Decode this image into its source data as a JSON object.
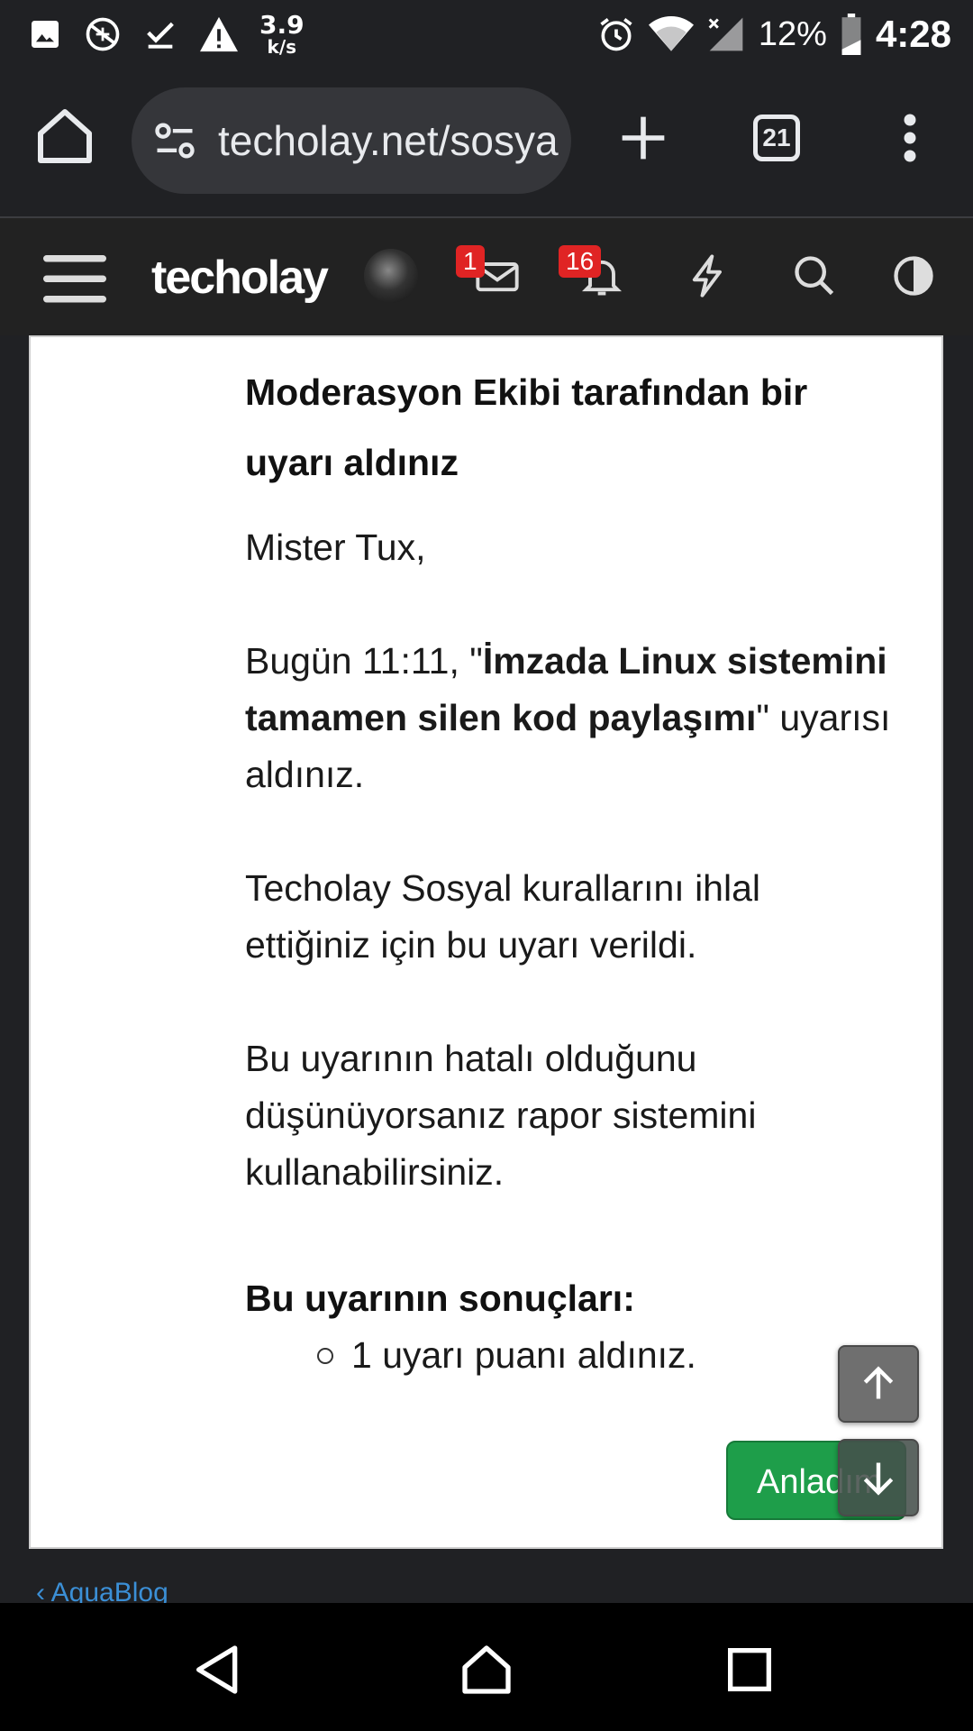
{
  "status_bar": {
    "net_speed_value": "3.9",
    "net_speed_unit": "k/s",
    "battery": "12%",
    "time": "4:28",
    "icons": [
      "image-icon",
      "no-sync-icon",
      "download-done-icon",
      "warning-icon",
      "alarm-icon",
      "wifi-icon",
      "signal-icon",
      "battery-icon"
    ]
  },
  "browser": {
    "url": "techolay.net/sosyal",
    "tab_count": "21"
  },
  "site_header": {
    "logo": "techolay",
    "messages_badge": "1",
    "notifications_badge": "16"
  },
  "warning": {
    "title": "Moderasyon Ekibi tarafından bir uyarı aldınız",
    "greeting": "Mister Tux,",
    "line1_prefix": "Bugün 11:11, \"",
    "line1_bold": "İmzada Linux sistemini tamamen silen kod paylaşımı",
    "line1_suffix": "\" uyarısı aldınız.",
    "paragraph2": "Techolay Sosyal kurallarını ihlal ettiğiniz için bu uyarı verildi.",
    "paragraph3": "Bu uyarının hatalı olduğunu düşünüyorsanız rapor sistemini kullanabilirsiniz.",
    "consequences_title": "Bu uyarının sonuçları:",
    "consequences": [
      "1 uyarı puanı aldınız."
    ],
    "ok_button": "Anladım"
  },
  "below_card_link": "AquaBlog"
}
